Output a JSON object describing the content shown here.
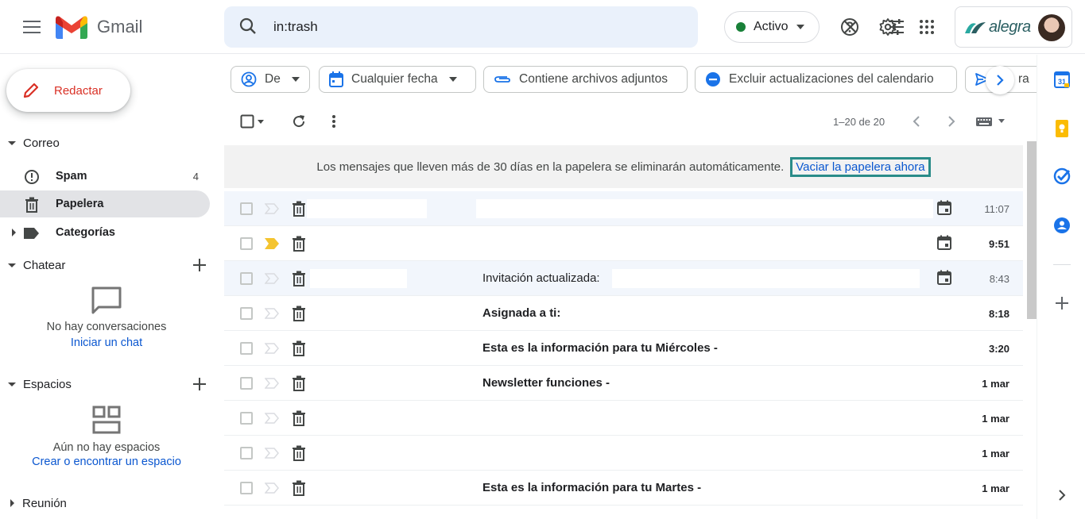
{
  "header": {
    "app_name": "Gmail",
    "search_value": "in:trash",
    "status_label": "Activo",
    "brand_name": "alegra"
  },
  "sidebar": {
    "compose_label": "Redactar",
    "mail_section": "Correo",
    "items": [
      {
        "label": "Spam",
        "count": "4"
      },
      {
        "label": "Papelera",
        "count": ""
      },
      {
        "label": "Categorías",
        "count": ""
      }
    ],
    "chat_section": "Chatear",
    "chat_empty": "No hay conversaciones",
    "chat_link": "Iniciar un chat",
    "spaces_section": "Espacios",
    "spaces_empty": "Aún no hay espacios",
    "spaces_link": "Crear o encontrar un espacio",
    "meeting_section": "Reunión"
  },
  "filters": {
    "from": "De",
    "date": "Cualquier fecha",
    "attachments": "Contiene archivos adjuntos",
    "exclude_calendar": "Excluir actualizaciones del calendario",
    "sent_partial": "ra"
  },
  "toolbar": {
    "range": "1–20 de 20"
  },
  "notice": {
    "text": "Los mensajes que lleven más de 30 días en la papelera se eliminarán automáticamente.",
    "link": "Vaciar la papelera ahora"
  },
  "emails": [
    {
      "subject": "",
      "time": "11:07",
      "unread": false,
      "important": false,
      "calendar": true
    },
    {
      "subject": "",
      "time": "9:51",
      "unread": true,
      "important": true,
      "calendar": true
    },
    {
      "subject": "Invitación actualizada:",
      "time": "8:43",
      "unread": false,
      "important": false,
      "calendar": true
    },
    {
      "subject": "Asignada a ti:",
      "time": "8:18",
      "unread": true,
      "important": false,
      "calendar": false
    },
    {
      "subject": "Esta es la información para tu Miércoles -",
      "time": "3:20",
      "unread": true,
      "important": false,
      "calendar": false
    },
    {
      "subject": "Newsletter funciones -",
      "time": "1 mar",
      "unread": true,
      "important": false,
      "calendar": false
    },
    {
      "subject": "",
      "time": "1 mar",
      "unread": true,
      "important": false,
      "calendar": false
    },
    {
      "subject": "",
      "time": "1 mar",
      "unread": true,
      "important": false,
      "calendar": false
    },
    {
      "subject": "Esta es la información para tu Martes -",
      "time": "1 mar",
      "unread": true,
      "important": false,
      "calendar": false
    }
  ],
  "colors": {
    "accent": "#0b57d0",
    "compose_red": "#d93025",
    "active_green": "#188038",
    "important_yellow": "#f4c430"
  }
}
